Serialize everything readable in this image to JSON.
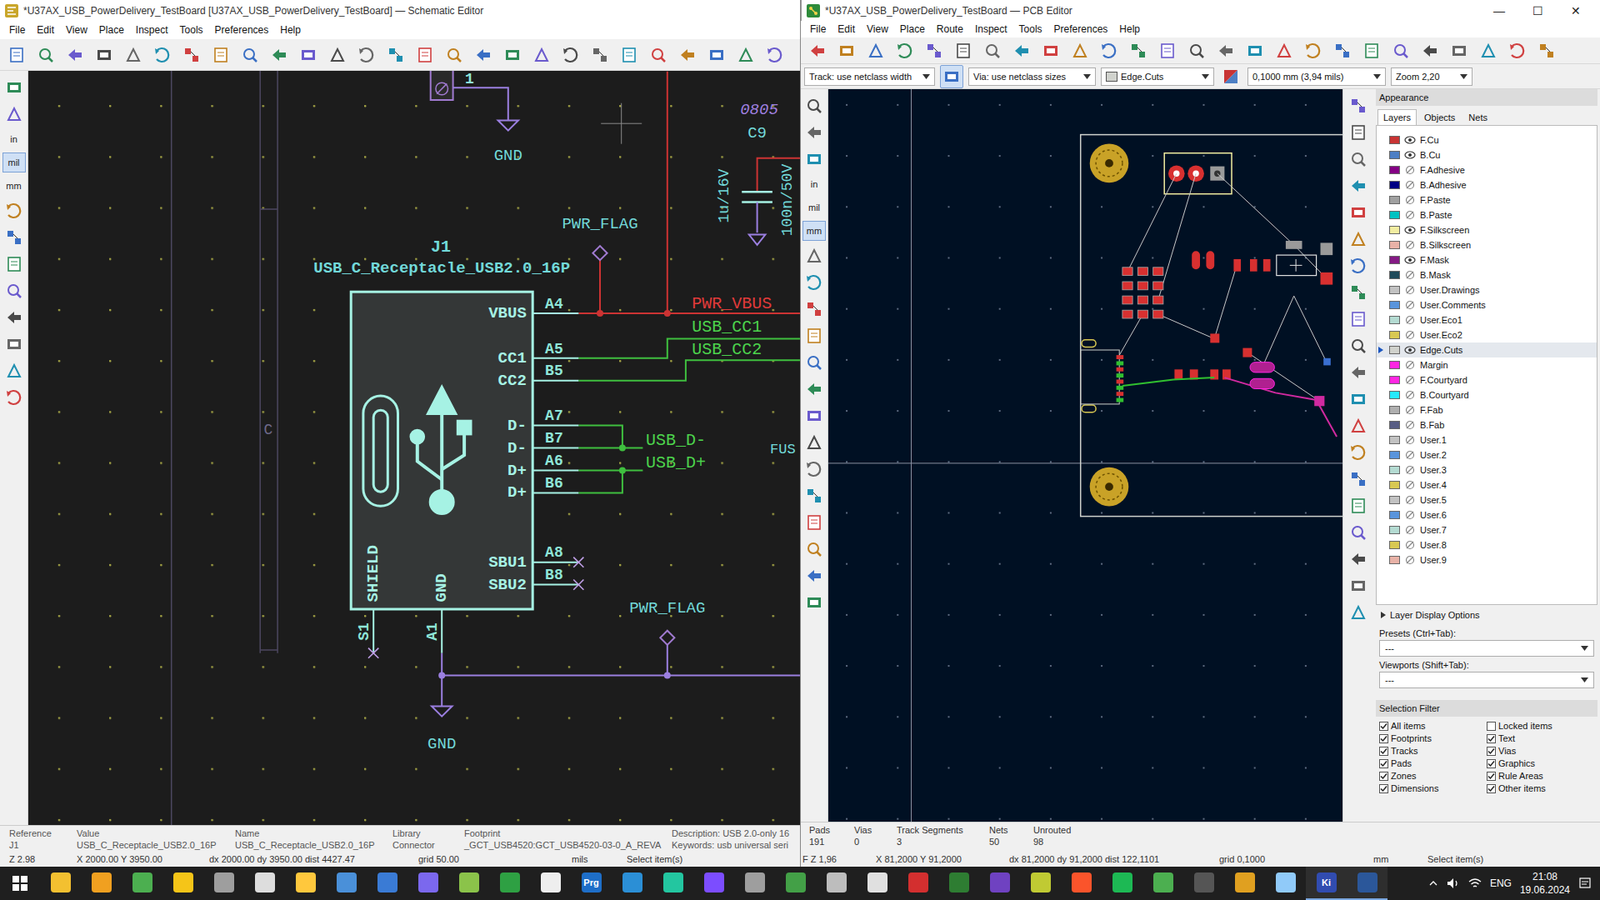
{
  "schematic": {
    "title": "*U37AX_USB_PowerDelivery_TestBoard [U37AX_USB_PowerDelivery_TestBoard] — Schematic Editor",
    "menu": [
      "File",
      "Edit",
      "View",
      "Place",
      "Inspect",
      "Tools",
      "Preferences",
      "Help"
    ],
    "units": [
      {
        "label": "in",
        "selected": false
      },
      {
        "label": "mil",
        "selected": true
      },
      {
        "label": "mm",
        "selected": false
      }
    ],
    "symbol": {
      "reference": "J1",
      "value": "USB_C_Receptacle_USB2.0_16P",
      "pins": [
        {
          "name": "VBUS",
          "number": "A4",
          "no_connect": false
        },
        {
          "name": "CC1",
          "number": "A5",
          "no_connect": false
        },
        {
          "name": "CC2",
          "number": "B5",
          "no_connect": false
        },
        {
          "name": "D-",
          "number": "A7",
          "no_connect": false
        },
        {
          "name": "D-",
          "number": "B7",
          "no_connect": false
        },
        {
          "name": "D+",
          "number": "A6",
          "no_connect": false
        },
        {
          "name": "D+",
          "number": "B6",
          "no_connect": false
        },
        {
          "name": "SBU1",
          "number": "A8",
          "no_connect": true
        },
        {
          "name": "SBU2",
          "number": "B8",
          "no_connect": true
        }
      ],
      "bottom_pins": [
        {
          "name": "SHIELD",
          "number": "S1",
          "no_connect": true
        },
        {
          "name": "GND",
          "number": "A1",
          "no_connect": false
        }
      ]
    },
    "net_labels": [
      {
        "text": "PWR_VBUS",
        "color": "#e03a3a"
      },
      {
        "text": "USB_CC1",
        "color": "#4cd44c"
      },
      {
        "text": "USB_CC2",
        "color": "#4cd44c"
      },
      {
        "text": "USB_D-",
        "color": "#4cd44c"
      },
      {
        "text": "USB_D+",
        "color": "#4cd44c"
      }
    ],
    "power_symbols": [
      {
        "text": "GND",
        "kind": "ground"
      },
      {
        "text": "PWR_FLAG",
        "kind": "flag"
      },
      {
        "text": "PWR_FLAG",
        "kind": "flag"
      },
      {
        "text": "GND",
        "kind": "ground"
      }
    ],
    "capacitor": {
      "reference": "C9",
      "package": "0805",
      "values": [
        "1u/16V",
        "100n/50V"
      ]
    },
    "partial_pin": "1",
    "sheet_row": "C",
    "cut_label": "FUS",
    "status": {
      "fields": [
        {
          "label": "Reference",
          "value": "J1"
        },
        {
          "label": "Value",
          "value": "USB_C_Receptacle_USB2.0_16P"
        },
        {
          "label": "Name",
          "value": "USB_C_Receptacle_USB2.0_16P"
        },
        {
          "label": "Library",
          "value": "Connector"
        },
        {
          "label": "Footprint",
          "value": "_GCT_USB4520:GCT_USB4520-03-0_A_REVA"
        }
      ],
      "description": "Description: USB 2.0-only 16",
      "keywords": "Keywords: usb universal seri",
      "bottom": [
        "Z 2.98",
        "X 2000.00 Y 3950.00",
        "dx 2000.00 dy 3950.00 dist 4427.47",
        "grid 50.00",
        "mils",
        "Select item(s)"
      ]
    }
  },
  "pcb": {
    "title": "*U37AX_USB_PowerDelivery_TestBoard — PCB Editor",
    "window_controls": [
      "—",
      "☐",
      "✕"
    ],
    "menu": [
      "File",
      "Edit",
      "View",
      "Place",
      "Route",
      "Inspect",
      "Tools",
      "Preferences",
      "Help"
    ],
    "track_select": "Track: use netclass width",
    "via_select": "Via: use netclass sizes",
    "layer_select": "Edge.Cuts",
    "grid_select": "0,1000 mm (3,94 mils)",
    "zoom_select": "Zoom 2,20",
    "units": [
      {
        "label": "in",
        "selected": false
      },
      {
        "label": "mil",
        "selected": false
      },
      {
        "label": "mm",
        "selected": true
      }
    ],
    "appearance": {
      "title": "Appearance",
      "tabs": [
        {
          "label": "Layers",
          "selected": true
        },
        {
          "label": "Objects",
          "selected": false
        },
        {
          "label": "Nets",
          "selected": false
        }
      ],
      "layers": [
        {
          "name": "F.Cu",
          "color": "#c83434",
          "visible": true,
          "selected": false
        },
        {
          "name": "B.Cu",
          "color": "#4d7fc4",
          "visible": true,
          "selected": false
        },
        {
          "name": "F.Adhesive",
          "color": "#840084",
          "visible": false,
          "selected": false
        },
        {
          "name": "B.Adhesive",
          "color": "#000084",
          "visible": false,
          "selected": false
        },
        {
          "name": "F.Paste",
          "color": "#a0a0a0",
          "visible": false,
          "selected": false
        },
        {
          "name": "B.Paste",
          "color": "#00c2c2",
          "visible": false,
          "selected": false
        },
        {
          "name": "F.Silkscreen",
          "color": "#f2eda1",
          "visible": true,
          "selected": false
        },
        {
          "name": "B.Silkscreen",
          "color": "#e8b2a7",
          "visible": false,
          "selected": false
        },
        {
          "name": "F.Mask",
          "color": "#841a84",
          "visible": true,
          "selected": false
        },
        {
          "name": "B.Mask",
          "color": "#1f4a5a",
          "visible": false,
          "selected": false
        },
        {
          "name": "User.Drawings",
          "color": "#c2c2c2",
          "visible": false,
          "selected": false
        },
        {
          "name": "User.Comments",
          "color": "#5994dc",
          "visible": false,
          "selected": false
        },
        {
          "name": "User.Eco1",
          "color": "#b4dbd2",
          "visible": false,
          "selected": false
        },
        {
          "name": "User.Eco2",
          "color": "#d8c852",
          "visible": false,
          "selected": false
        },
        {
          "name": "Edge.Cuts",
          "color": "#d0d2cd",
          "visible": true,
          "selected": true
        },
        {
          "name": "Margin",
          "color": "#ff26e2",
          "visible": false,
          "selected": false
        },
        {
          "name": "F.Courtyard",
          "color": "#ff26e2",
          "visible": false,
          "selected": false
        },
        {
          "name": "B.Courtyard",
          "color": "#26e9ff",
          "visible": false,
          "selected": false
        },
        {
          "name": "F.Fab",
          "color": "#afafaf",
          "visible": false,
          "selected": false
        },
        {
          "name": "B.Fab",
          "color": "#585d84",
          "visible": false,
          "selected": false
        },
        {
          "name": "User.1",
          "color": "#c2c2c2",
          "visible": false,
          "selected": false
        },
        {
          "name": "User.2",
          "color": "#5994dc",
          "visible": false,
          "selected": false
        },
        {
          "name": "User.3",
          "color": "#b4dbd2",
          "visible": false,
          "selected": false
        },
        {
          "name": "User.4",
          "color": "#d8c852",
          "visible": false,
          "selected": false
        },
        {
          "name": "User.5",
          "color": "#c2c2c2",
          "visible": false,
          "selected": false
        },
        {
          "name": "User.6",
          "color": "#5994dc",
          "visible": false,
          "selected": false
        },
        {
          "name": "User.7",
          "color": "#b4dbd2",
          "visible": false,
          "selected": false
        },
        {
          "name": "User.8",
          "color": "#d8c852",
          "visible": false,
          "selected": false
        },
        {
          "name": "User.9",
          "color": "#e8b2a7",
          "visible": false,
          "selected": false
        }
      ],
      "display_options": "Layer Display Options",
      "presets_label": "Presets (Ctrl+Tab):",
      "presets_value": "---",
      "viewports_label": "Viewports (Shift+Tab):",
      "viewports_value": "---"
    },
    "selection_filter": {
      "title": "Selection Filter",
      "items": [
        {
          "label": "All items",
          "checked": true
        },
        {
          "label": "Locked items",
          "checked": false
        },
        {
          "label": "Footprints",
          "checked": true
        },
        {
          "label": "Text",
          "checked": true
        },
        {
          "label": "Tracks",
          "checked": true
        },
        {
          "label": "Vias",
          "checked": true
        },
        {
          "label": "Pads",
          "checked": true
        },
        {
          "label": "Graphics",
          "checked": true
        },
        {
          "label": "Zones",
          "checked": true
        },
        {
          "label": "Rule Areas",
          "checked": true
        },
        {
          "label": "Dimensions",
          "checked": true
        },
        {
          "label": "Other items",
          "checked": true
        }
      ]
    },
    "stats": [
      {
        "label": "Pads",
        "value": "191"
      },
      {
        "label": "Vias",
        "value": "0"
      },
      {
        "label": "Track Segments",
        "value": "3"
      },
      {
        "label": "Nets",
        "value": "50"
      },
      {
        "label": "Unrouted",
        "value": "98"
      }
    ],
    "bottom": [
      "F Z 1,96",
      "X 81,2000 Y 91,2000",
      "dx 81,2000 dy 91,2000 dist 122,1101",
      "grid 0,1000",
      "mm",
      "Select item(s)"
    ]
  },
  "taskbar": {
    "apps": [
      {
        "color": "#f3c030",
        "text": "",
        "active": false
      },
      {
        "color": "#f0a020",
        "text": "",
        "active": false
      },
      {
        "color": "#4caf50",
        "text": "",
        "active": false
      },
      {
        "color": "#f5c518",
        "text": "",
        "active": false
      },
      {
        "color": "#9e9e9e",
        "text": "",
        "active": false
      },
      {
        "color": "#dddddd",
        "text": "",
        "active": false
      },
      {
        "color": "#ffc83d",
        "text": "",
        "active": false
      },
      {
        "color": "#4a90d9",
        "text": "",
        "active": false
      },
      {
        "color": "#3a7bd5",
        "text": "",
        "active": false
      },
      {
        "color": "#7b68ee",
        "text": "",
        "active": false
      },
      {
        "color": "#8bc34a",
        "text": "",
        "active": false
      },
      {
        "color": "#2ea043",
        "text": "",
        "active": false
      },
      {
        "color": "#eeeeee",
        "text": "",
        "active": false
      },
      {
        "color": "#1e6ec8",
        "text": "Prg",
        "active": false
      },
      {
        "color": "#2b8fd6",
        "text": "",
        "active": false
      },
      {
        "color": "#23c6a0",
        "text": "",
        "active": false
      },
      {
        "color": "#7c4dff",
        "text": "",
        "active": false
      },
      {
        "color": "#9e9e9e",
        "text": "",
        "active": false
      },
      {
        "color": "#43a047",
        "text": "",
        "active": false
      },
      {
        "color": "#bdbdbd",
        "text": "",
        "active": false
      },
      {
        "color": "#e0e0e0",
        "text": "",
        "active": false
      },
      {
        "color": "#d32f2f",
        "text": "",
        "active": false
      },
      {
        "color": "#2e7d32",
        "text": "",
        "active": false
      },
      {
        "color": "#6f42c1",
        "text": "",
        "active": false
      },
      {
        "color": "#c0ca33",
        "text": "",
        "active": false
      },
      {
        "color": "#fb542b",
        "text": "",
        "active": false
      },
      {
        "color": "#1db954",
        "text": "",
        "active": false
      },
      {
        "color": "#4caf50",
        "text": "",
        "active": false
      },
      {
        "color": "#555555",
        "text": "",
        "active": false
      },
      {
        "color": "#e0a020",
        "text": "",
        "active": false
      },
      {
        "color": "#90caf9",
        "text": "",
        "active": false
      },
      {
        "color": "#314cb0",
        "text": "Ki",
        "active": true
      },
      {
        "color": "#2b579a",
        "text": "",
        "active": true
      }
    ],
    "language": "ENG",
    "time": "21:08",
    "date": "19.06.2024"
  }
}
